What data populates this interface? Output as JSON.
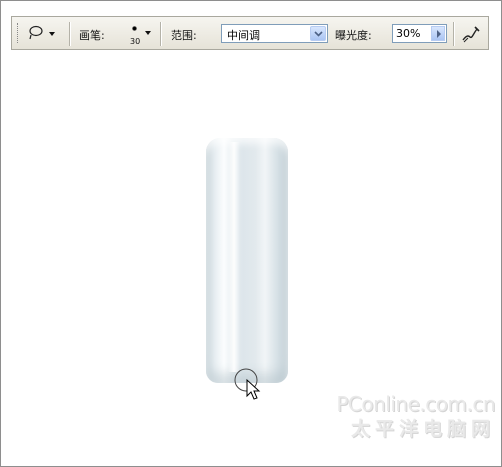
{
  "toolbar": {
    "brush_label": "画笔:",
    "brush_size": "30",
    "range_label": "范围:",
    "range_value": "中间调",
    "exposure_label": "曝光度:",
    "exposure_value": "30%"
  },
  "icons": {
    "tool": "dodge-tool-icon",
    "airbrush": "airbrush-icon",
    "cursor": "brush-cursor-icon"
  },
  "watermark": {
    "line1": "PConline.com.cn",
    "line2": "太平洋电脑网"
  }
}
